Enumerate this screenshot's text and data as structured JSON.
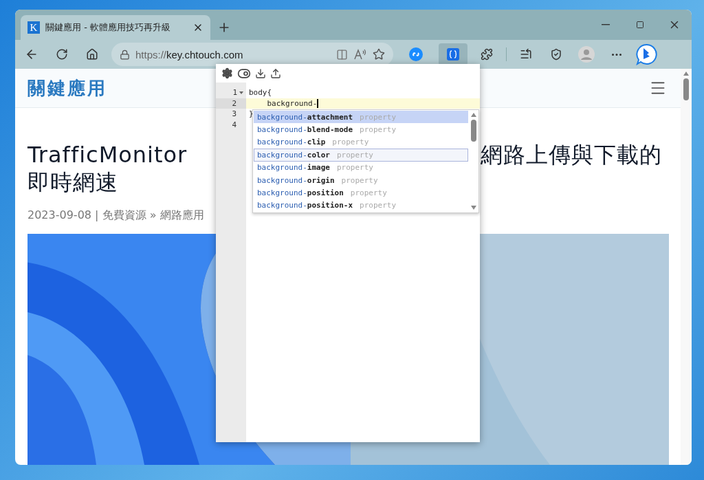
{
  "browser": {
    "tabs": [
      {
        "favicon": "K",
        "title": "關鍵應用 - 軟體應用技巧再升級",
        "selected": true
      }
    ],
    "address_scheme": "https://",
    "address_host": "key.chtouch.com",
    "extensions": [
      {
        "kind": "shazam",
        "active": false
      },
      {
        "kind": "braces",
        "active": true
      }
    ]
  },
  "site": {
    "logo": "關鍵應用"
  },
  "article": {
    "title_start": "TrafficMonitor",
    "title_end": "網路上傳與下載的",
    "title_line2": "即時網速",
    "meta": "2023-09-08 | 免費資源 » 網路應用"
  },
  "editor": {
    "lines": [
      {
        "number": "1",
        "text": "body{",
        "active": false,
        "foldable": true
      },
      {
        "number": "2",
        "text": "    background-",
        "active": true,
        "foldable": false
      },
      {
        "number": "3",
        "text": "}",
        "active": false,
        "foldable": false
      },
      {
        "number": "4",
        "active": false,
        "foldable": false
      }
    ],
    "suggestions": [
      {
        "match": "background-",
        "rest": "attachment",
        "type": "property",
        "selected": true,
        "hovered": false
      },
      {
        "match": "background-",
        "rest": "blend-mode",
        "type": "property",
        "selected": false,
        "hovered": false
      },
      {
        "match": "background-",
        "rest": "clip",
        "type": "property",
        "selected": false,
        "hovered": false
      },
      {
        "match": "background-",
        "rest": "color",
        "type": "property",
        "selected": false,
        "hovered": true
      },
      {
        "match": "background-",
        "rest": "image",
        "type": "property",
        "selected": false,
        "hovered": false
      },
      {
        "match": "background-",
        "rest": "origin",
        "type": "property",
        "selected": false,
        "hovered": false
      },
      {
        "match": "background-",
        "rest": "position",
        "type": "property",
        "selected": false,
        "hovered": false
      },
      {
        "match": "background-",
        "rest": "position-x",
        "type": "property",
        "selected": false,
        "hovered": false
      }
    ]
  }
}
